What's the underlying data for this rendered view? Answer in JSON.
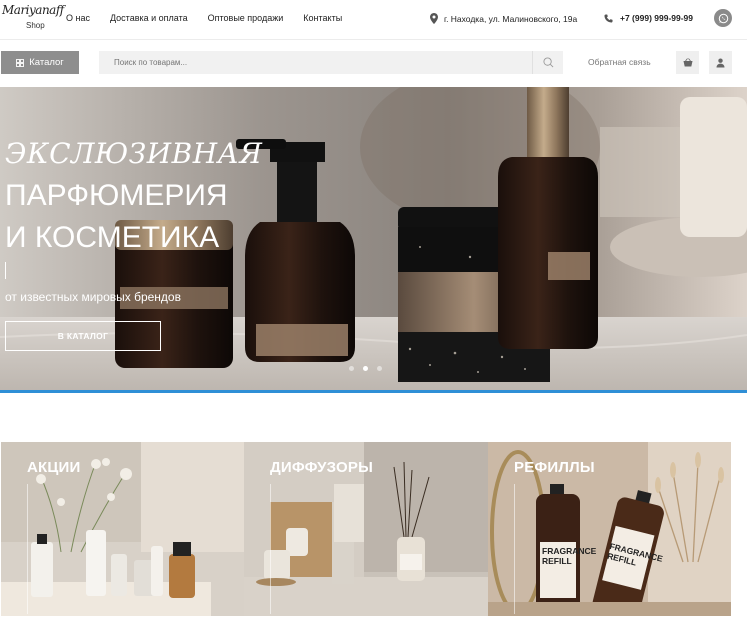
{
  "logo": {
    "script": "Mariyanaff",
    "sub": "Shop"
  },
  "nav": {
    "items": [
      "О нас",
      "Доставка и оплата",
      "Оптовые продажи",
      "Контакты"
    ]
  },
  "contacts": {
    "address": "г. Находка, ул. Малиновского, 19а",
    "phone": "+7 (999) 999-99-99"
  },
  "toolbar": {
    "catalog_label": "Каталог",
    "search_placeholder": "Поиск по товарам...",
    "feedback_label": "Обратная связь"
  },
  "hero": {
    "line1": "ЭКСЛЮЗИВНАЯ",
    "line2": "ПАРФЮМЕРИЯ",
    "line3": "И КОСМЕТИКА",
    "subtitle": "от известных мировых брендов",
    "cta": "В КАТАЛОГ",
    "active_slide": 2,
    "slides": 3
  },
  "categories": [
    {
      "label": "АКЦИИ"
    },
    {
      "label": "ДИФФУЗОРЫ"
    },
    {
      "label": "РЕФИЛЛЫ"
    }
  ],
  "product_labels": {
    "refill_1": "FRAGRANCE REFILL",
    "refill_2": "FRAGRANCE REFILL"
  },
  "colors": {
    "accent": "#2f8fd6",
    "catalog_button": "#8e8e8e"
  }
}
